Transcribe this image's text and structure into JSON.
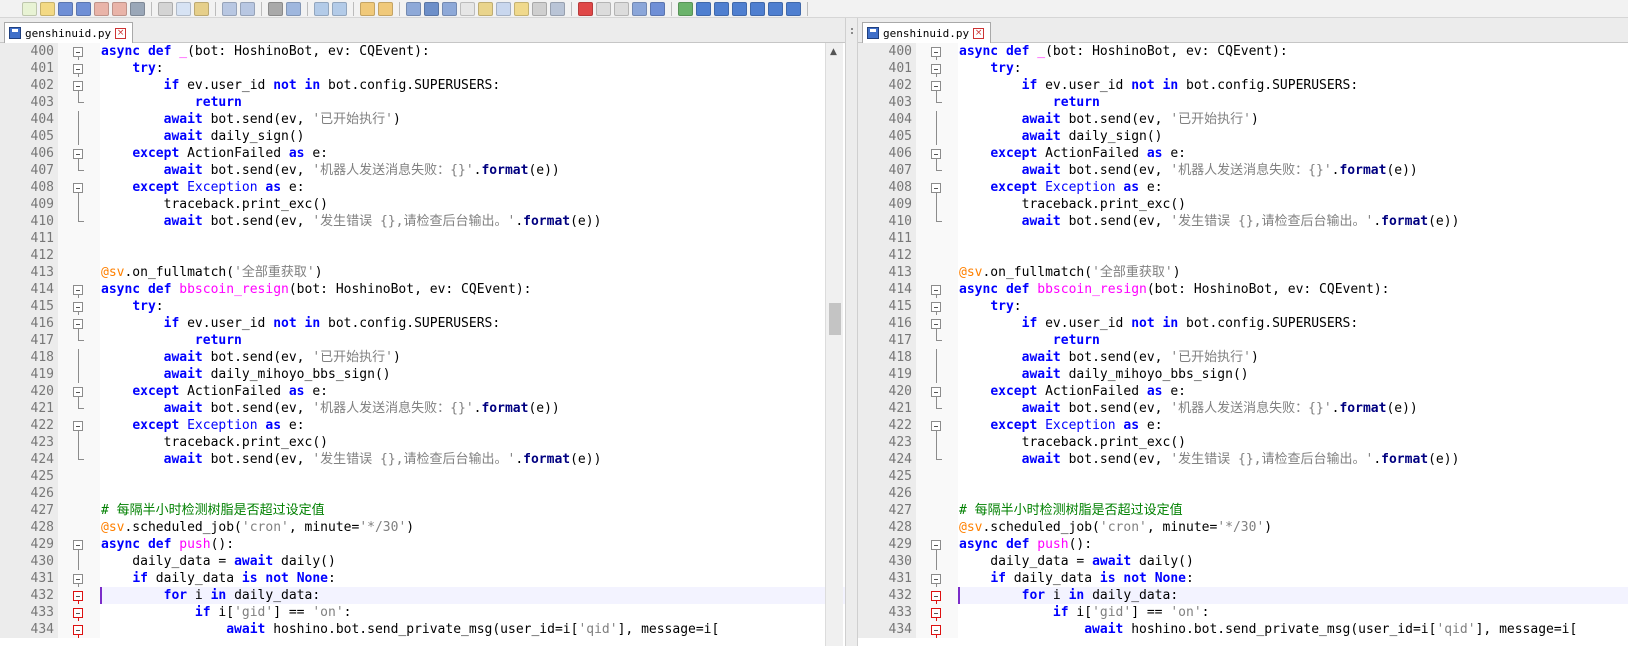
{
  "toolbar": {
    "groups": [
      [
        {
          "icon": "new-file-icon",
          "color": "#e8f3d4"
        },
        {
          "icon": "open-file-icon",
          "color": "#f3d984"
        },
        {
          "icon": "save-icon",
          "color": "#6f8fd6"
        },
        {
          "icon": "save-all-icon",
          "color": "#6f8fd6"
        },
        {
          "icon": "close-icon",
          "color": "#e9b4a9"
        },
        {
          "icon": "close-all-icon",
          "color": "#e9b4a9"
        },
        {
          "icon": "print-icon",
          "color": "#9aa7b8"
        }
      ],
      [
        {
          "icon": "cut-icon",
          "color": "#d4d4d4"
        },
        {
          "icon": "copy-icon",
          "color": "#d7e3f4"
        },
        {
          "icon": "paste-icon",
          "color": "#e6cf8a"
        }
      ],
      [
        {
          "icon": "undo-icon",
          "color": "#b8c7e2"
        },
        {
          "icon": "redo-icon",
          "color": "#b8c7e2"
        }
      ],
      [
        {
          "icon": "find-icon",
          "color": "#a9a9a9"
        },
        {
          "icon": "replace-icon",
          "color": "#9fb7de"
        }
      ],
      [
        {
          "icon": "zoom-in-icon",
          "color": "#b3cbe8"
        },
        {
          "icon": "zoom-out-icon",
          "color": "#b3cbe8"
        }
      ],
      [
        {
          "icon": "sync-vertical-icon",
          "color": "#f0c97a"
        },
        {
          "icon": "sync-horizontal-icon",
          "color": "#f0c97a"
        }
      ],
      [
        {
          "icon": "word-wrap-icon",
          "color": "#8ea9d8"
        },
        {
          "icon": "show-all-chars-icon",
          "color": "#6d8fc9"
        },
        {
          "icon": "indent-guide-icon",
          "color": "#8ea9d8"
        },
        {
          "icon": "lang-user-icon",
          "color": "#e6e6e6"
        },
        {
          "icon": "doc-map-icon",
          "color": "#e9d48c"
        },
        {
          "icon": "function-list-icon",
          "color": "#c9d7ee"
        },
        {
          "icon": "folder-workspace-icon",
          "color": "#f0d98c"
        },
        {
          "icon": "monitor-icon",
          "color": "#cfcfcf"
        },
        {
          "icon": "view-icon",
          "color": "#b9c4d6"
        }
      ],
      [
        {
          "icon": "record-macro-icon",
          "color": "#e04848"
        },
        {
          "icon": "stop-macro-icon",
          "color": "#dcdcdc"
        },
        {
          "icon": "play-macro-icon",
          "color": "#dcdcdc"
        },
        {
          "icon": "run-macro-multiple-icon",
          "color": "#8ba6d9"
        },
        {
          "icon": "save-macro-icon",
          "color": "#6f8fd6"
        }
      ],
      [
        {
          "icon": "compare-icon",
          "color": "#6bb36b"
        },
        {
          "icon": "compare-table-icon",
          "color": "#4f7fd0"
        },
        {
          "icon": "compare-first-icon",
          "color": "#4f7fd0"
        },
        {
          "icon": "compare-prev-icon",
          "color": "#4f7fd0"
        },
        {
          "icon": "compare-next-icon",
          "color": "#4f7fd0"
        },
        {
          "icon": "compare-last-icon",
          "color": "#4f7fd0"
        },
        {
          "icon": "compare-panel-icon",
          "color": "#4f7fd0"
        }
      ]
    ]
  },
  "left_pane": {
    "tab_label": "genshinuid.py",
    "tab_close": "×"
  },
  "right_pane": {
    "tab_label": "genshinuid.py",
    "tab_close": "×"
  },
  "scrollbar": {
    "up_arrow": "▲"
  },
  "code_lines": [
    {
      "num": "400",
      "fold": "start",
      "tokens": [
        [
          "async def",
          "kw"
        ],
        [
          " "
        ],
        [
          "_",
          "fn"
        ],
        [
          "(bot: HoshinoBot, ev: CQEvent):"
        ]
      ]
    },
    {
      "num": "401",
      "fold": "start",
      "tokens": [
        [
          "    "
        ],
        [
          "try",
          "kw"
        ],
        [
          ":"
        ]
      ]
    },
    {
      "num": "402",
      "fold": "start",
      "tokens": [
        [
          "        "
        ],
        [
          "if",
          "kw"
        ],
        [
          " ev.user_id "
        ],
        [
          "not in",
          "kw"
        ],
        [
          " bot.config.SUPERUSERS:"
        ]
      ]
    },
    {
      "num": "403",
      "fold": "end",
      "tokens": [
        [
          "            "
        ],
        [
          "return",
          "kw"
        ]
      ]
    },
    {
      "num": "404",
      "fold": "line",
      "tokens": [
        [
          "        "
        ],
        [
          "await",
          "kw"
        ],
        [
          " bot.send(ev, "
        ],
        [
          "'已开始执行'",
          "str"
        ],
        [
          ")"
        ]
      ]
    },
    {
      "num": "405",
      "fold": "line",
      "tokens": [
        [
          "        "
        ],
        [
          "await",
          "kw"
        ],
        [
          " daily_sign()"
        ]
      ]
    },
    {
      "num": "406",
      "fold": "start",
      "tokens": [
        [
          "    "
        ],
        [
          "except",
          "kw"
        ],
        [
          " ActionFailed "
        ],
        [
          "as",
          "kw"
        ],
        [
          " e:"
        ]
      ]
    },
    {
      "num": "407",
      "fold": "end",
      "tokens": [
        [
          "        "
        ],
        [
          "await",
          "kw"
        ],
        [
          " bot.send(ev, "
        ],
        [
          "'机器人发送消息失败：{}'",
          "str"
        ],
        [
          "."
        ],
        [
          "format",
          "meth"
        ],
        [
          "(e))"
        ]
      ]
    },
    {
      "num": "408",
      "fold": "start",
      "tokens": [
        [
          "    "
        ],
        [
          "except",
          "kw"
        ],
        [
          " "
        ],
        [
          "Exception",
          "cls"
        ],
        [
          " "
        ],
        [
          "as",
          "kw"
        ],
        [
          " e:"
        ]
      ]
    },
    {
      "num": "409",
      "fold": "line",
      "tokens": [
        [
          "        traceback.print_exc()"
        ]
      ]
    },
    {
      "num": "410",
      "fold": "end",
      "tokens": [
        [
          "        "
        ],
        [
          "await",
          "kw"
        ],
        [
          " bot.send(ev, "
        ],
        [
          "'发生错误 {},请检查后台输出。'",
          "str"
        ],
        [
          "."
        ],
        [
          "format",
          "meth"
        ],
        [
          "(e))"
        ]
      ]
    },
    {
      "num": "411",
      "fold": "none",
      "tokens": []
    },
    {
      "num": "412",
      "fold": "none",
      "tokens": []
    },
    {
      "num": "413",
      "fold": "none",
      "tokens": [
        [
          "@sv",
          "dec"
        ],
        [
          ".on_fullmatch("
        ],
        [
          "'全部重获取'",
          "str"
        ],
        [
          ")"
        ]
      ]
    },
    {
      "num": "414",
      "fold": "start",
      "tokens": [
        [
          "async def",
          "kw"
        ],
        [
          " "
        ],
        [
          "bbscoin_resign",
          "fn"
        ],
        [
          "(bot: HoshinoBot, ev: CQEvent):"
        ]
      ]
    },
    {
      "num": "415",
      "fold": "start",
      "tokens": [
        [
          "    "
        ],
        [
          "try",
          "kw"
        ],
        [
          ":"
        ]
      ]
    },
    {
      "num": "416",
      "fold": "start",
      "tokens": [
        [
          "        "
        ],
        [
          "if",
          "kw"
        ],
        [
          " ev.user_id "
        ],
        [
          "not in",
          "kw"
        ],
        [
          " bot.config.SUPERUSERS:"
        ]
      ]
    },
    {
      "num": "417",
      "fold": "end",
      "tokens": [
        [
          "            "
        ],
        [
          "return",
          "kw"
        ]
      ]
    },
    {
      "num": "418",
      "fold": "line",
      "tokens": [
        [
          "        "
        ],
        [
          "await",
          "kw"
        ],
        [
          " bot.send(ev, "
        ],
        [
          "'已开始执行'",
          "str"
        ],
        [
          ")"
        ]
      ]
    },
    {
      "num": "419",
      "fold": "line",
      "tokens": [
        [
          "        "
        ],
        [
          "await",
          "kw"
        ],
        [
          " daily_mihoyo_bbs_sign()"
        ]
      ]
    },
    {
      "num": "420",
      "fold": "start",
      "tokens": [
        [
          "    "
        ],
        [
          "except",
          "kw"
        ],
        [
          " ActionFailed "
        ],
        [
          "as",
          "kw"
        ],
        [
          " e:"
        ]
      ]
    },
    {
      "num": "421",
      "fold": "end",
      "tokens": [
        [
          "        "
        ],
        [
          "await",
          "kw"
        ],
        [
          " bot.send(ev, "
        ],
        [
          "'机器人发送消息失败：{}'",
          "str"
        ],
        [
          "."
        ],
        [
          "format",
          "meth"
        ],
        [
          "(e))"
        ]
      ]
    },
    {
      "num": "422",
      "fold": "start",
      "tokens": [
        [
          "    "
        ],
        [
          "except",
          "kw"
        ],
        [
          " "
        ],
        [
          "Exception",
          "cls"
        ],
        [
          " "
        ],
        [
          "as",
          "kw"
        ],
        [
          " e:"
        ]
      ]
    },
    {
      "num": "423",
      "fold": "line",
      "tokens": [
        [
          "        traceback.print_exc()"
        ]
      ]
    },
    {
      "num": "424",
      "fold": "end",
      "tokens": [
        [
          "        "
        ],
        [
          "await",
          "kw"
        ],
        [
          " bot.send(ev, "
        ],
        [
          "'发生错误 {},请检查后台输出。'",
          "str"
        ],
        [
          "."
        ],
        [
          "format",
          "meth"
        ],
        [
          "(e))"
        ]
      ]
    },
    {
      "num": "425",
      "fold": "none",
      "tokens": []
    },
    {
      "num": "426",
      "fold": "none",
      "tokens": []
    },
    {
      "num": "427",
      "fold": "none",
      "tokens": [
        [
          "# 每隔半小时检测树脂是否超过设定值",
          "com"
        ]
      ]
    },
    {
      "num": "428",
      "fold": "none",
      "tokens": [
        [
          "@sv",
          "dec"
        ],
        [
          ".scheduled_job("
        ],
        [
          "'cron'",
          "str"
        ],
        [
          ", minute="
        ],
        [
          "'*/30'",
          "str"
        ],
        [
          ")"
        ]
      ]
    },
    {
      "num": "429",
      "fold": "start",
      "tokens": [
        [
          "async def",
          "kw"
        ],
        [
          " "
        ],
        [
          "push",
          "fn"
        ],
        [
          "():"
        ]
      ]
    },
    {
      "num": "430",
      "fold": "line",
      "tokens": [
        [
          "    daily_data = "
        ],
        [
          "await",
          "kw"
        ],
        [
          " daily()"
        ]
      ]
    },
    {
      "num": "431",
      "fold": "start",
      "tokens": [
        [
          "    "
        ],
        [
          "if",
          "kw"
        ],
        [
          " daily_data "
        ],
        [
          "is not",
          "kw"
        ],
        [
          " "
        ],
        [
          "None",
          "kw"
        ],
        [
          ":"
        ]
      ]
    },
    {
      "num": "432",
      "fold": "changed",
      "caret": true,
      "tokens": [
        [
          "        "
        ],
        [
          "for",
          "kw"
        ],
        [
          " i "
        ],
        [
          "in",
          "kw"
        ],
        [
          " daily_data:"
        ]
      ]
    },
    {
      "num": "433",
      "fold": "changed",
      "tokens": [
        [
          "            "
        ],
        [
          "if",
          "kw"
        ],
        [
          " i["
        ],
        [
          "'gid'",
          "str"
        ],
        [
          "] == "
        ],
        [
          "'on'",
          "str"
        ],
        [
          ":"
        ]
      ]
    },
    {
      "num": "434",
      "fold": "changed",
      "tokens": [
        [
          "                "
        ],
        [
          "await",
          "kw"
        ],
        [
          " hoshino.bot.send_private_msg(user_id=i["
        ],
        [
          "'qid'",
          "str"
        ],
        [
          "], message=i["
        ]
      ]
    }
  ]
}
